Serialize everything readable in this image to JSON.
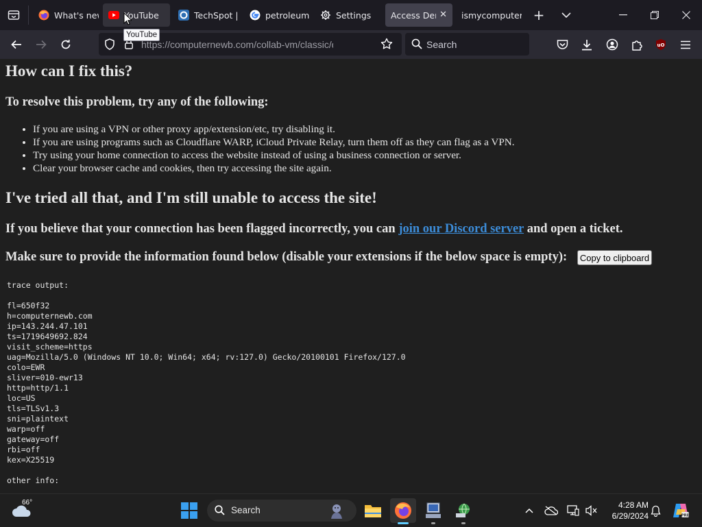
{
  "browser": {
    "tabs": [
      {
        "label": "What's new",
        "icon": "firefox-icon"
      },
      {
        "label": "YouTube",
        "icon": "youtube-icon"
      },
      {
        "label": "TechSpot |",
        "icon": "techspot-icon"
      },
      {
        "label": "petroleum",
        "icon": "google-icon"
      },
      {
        "label": "Settings",
        "icon": "gear-icon"
      },
      {
        "label": "Access Denied",
        "icon": "none"
      },
      {
        "label": "ismycomputerok",
        "icon": "none"
      }
    ],
    "tooltip": "YouTube",
    "url_host": "https://computernewb.com",
    "url_path": "/collab-vm/classic/denied.htm",
    "search_placeholder": "Search",
    "accent_color": "#3c8cd8"
  },
  "page": {
    "heading_fix": "How can I fix this?",
    "resolve_heading": "To resolve this problem, try any of the following:",
    "tips": [
      "If you are using a VPN or other proxy app/extension/etc, try disabling it.",
      "If you are using programs such as Cloudflare WARP, iCloud Private Relay, turn them off as they can flag as a VPN.",
      "Try using your home connection to access the website instead of using a business connection or server.",
      "Clear your browser cache and cookies, then try accessing the site again."
    ],
    "heading_tried": "I've tried all that, and I'm still unable to access the site!",
    "flagged_prefix": "If you believe that your connection has been flagged incorrectly, you can ",
    "discord_link": "join our Discord server",
    "flagged_suffix": " and open a ticket.",
    "provide_text": "Make sure to provide the information found below (disable your extensions if the below space is empty):",
    "copy_button": "Copy to clipboard",
    "trace_lines": [
      "trace output:",
      "",
      "fl=650f32",
      "h=computernewb.com",
      "ip=143.244.47.101",
      "ts=1719649692.824",
      "visit_scheme=https",
      "uag=Mozilla/5.0 (Windows NT 10.0; Win64; x64; rv:127.0) Gecko/20100101 Firefox/127.0",
      "colo=EWR",
      "sliver=010-ewr13",
      "http=http/1.1",
      "loc=US",
      "tls=TLSv1.3",
      "sni=plaintext",
      "warp=off",
      "gateway=off",
      "rbi=off",
      "kex=X25519",
      "",
      "other info:"
    ]
  },
  "taskbar": {
    "weather_temp": "66°",
    "search_label": "Search",
    "time": "4:28 AM",
    "date": "6/29/2024"
  }
}
